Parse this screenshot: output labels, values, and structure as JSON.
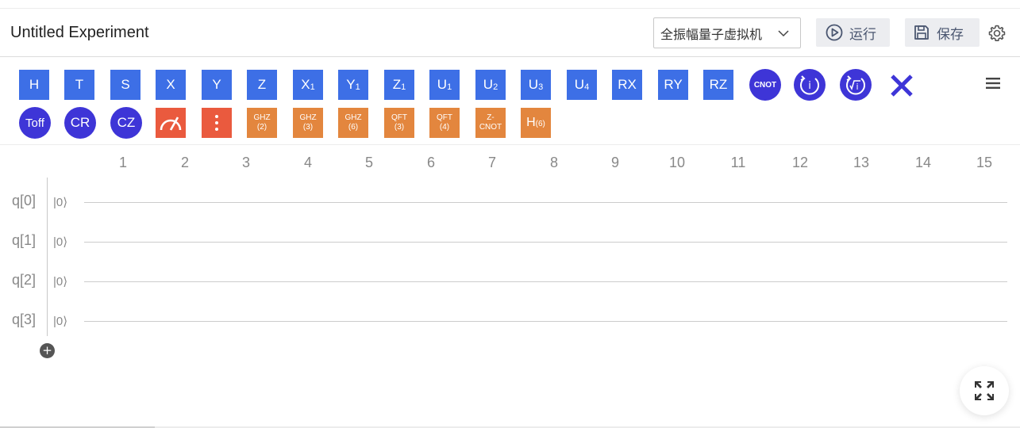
{
  "header": {
    "title": "Untitled Experiment",
    "backend_select": "全振幅量子虚拟机",
    "run_label": "运行",
    "save_label": "保存"
  },
  "palette": {
    "row1": [
      {
        "label": "H",
        "sub": ""
      },
      {
        "label": "T",
        "sub": ""
      },
      {
        "label": "S",
        "sub": ""
      },
      {
        "label": "X",
        "sub": ""
      },
      {
        "label": "Y",
        "sub": ""
      },
      {
        "label": "Z",
        "sub": ""
      },
      {
        "label": "X",
        "sub": "1"
      },
      {
        "label": "Y",
        "sub": "1"
      },
      {
        "label": "Z",
        "sub": "1"
      },
      {
        "label": "U",
        "sub": "1"
      },
      {
        "label": "U",
        "sub": "2"
      },
      {
        "label": "U",
        "sub": "3"
      },
      {
        "label": "U",
        "sub": "4"
      },
      {
        "label": "RX",
        "sub": ""
      },
      {
        "label": "RY",
        "sub": ""
      },
      {
        "label": "RZ",
        "sub": ""
      },
      {
        "label": "CNOT",
        "sub": ""
      }
    ],
    "row2_circles": [
      "Toff",
      "CR",
      "CZ"
    ],
    "row2_orange": [
      {
        "line1": "GHZ",
        "line2": "(2)"
      },
      {
        "line1": "GHZ",
        "line2": "(3)"
      },
      {
        "line1": "GHZ",
        "line2": "(6)"
      },
      {
        "line1": "QFT",
        "line2": "(3)"
      },
      {
        "line1": "QFT",
        "line2": "(4)"
      },
      {
        "line1": "Z-",
        "line2": "CNOT"
      }
    ],
    "h6_label": "H",
    "h6_sub": "(6)",
    "extra_icons": [
      "measure-icon",
      "barrier-icon",
      "i-gate-icon",
      "sqrt-i-gate-icon",
      "delete-icon",
      "menu-icon"
    ]
  },
  "columns": [
    "1",
    "2",
    "3",
    "4",
    "5",
    "6",
    "7",
    "8",
    "9",
    "10",
    "11",
    "12",
    "13",
    "14",
    "15"
  ],
  "qubits": [
    {
      "label": "q[0]",
      "ket": "|0⟩"
    },
    {
      "label": "q[1]",
      "ket": "|0⟩"
    },
    {
      "label": "q[2]",
      "ket": "|0⟩"
    },
    {
      "label": "q[3]",
      "ket": "|0⟩"
    }
  ],
  "add_qubit_label": "+",
  "colors": {
    "gate_blue": "#3d6fe6",
    "gate_circle": "#3e35d7",
    "gate_orange": "#e3863e",
    "gate_red": "#ea5a3e"
  }
}
